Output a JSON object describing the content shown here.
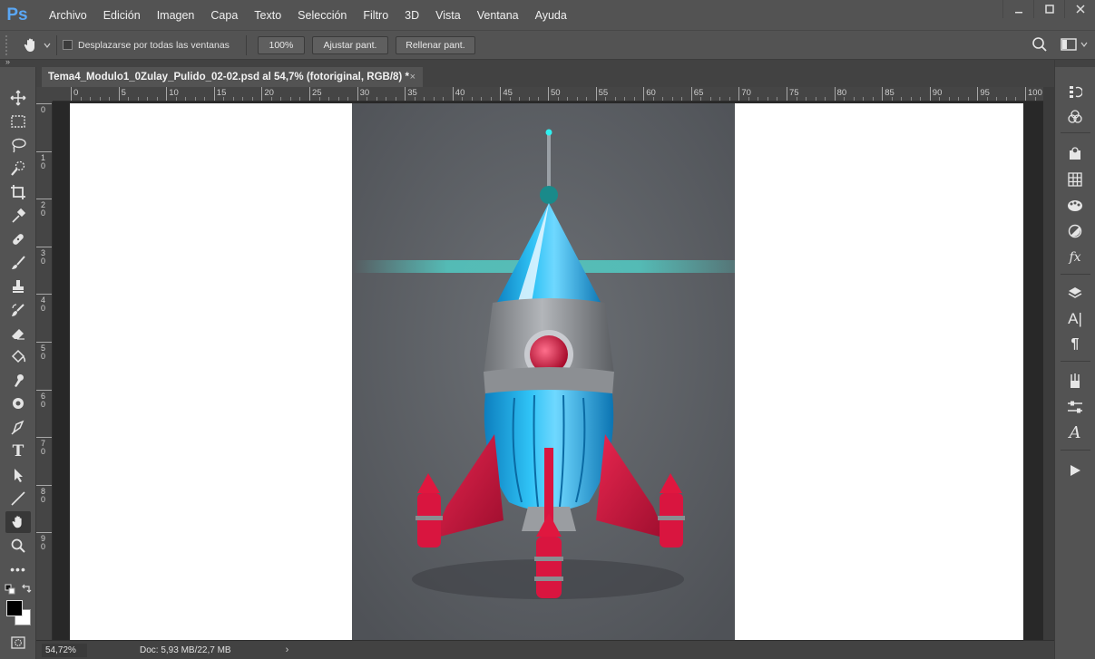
{
  "app": {
    "logo": "Ps"
  },
  "menu": [
    "Archivo",
    "Edición",
    "Imagen",
    "Capa",
    "Texto",
    "Selección",
    "Filtro",
    "3D",
    "Vista",
    "Ventana",
    "Ayuda"
  ],
  "options": {
    "scroll_all_label": "Desplazarse por todas las ventanas",
    "zoom_value": "100%",
    "fit_screen_label": "Ajustar pant.",
    "fill_screen_label": "Rellenar pant."
  },
  "document": {
    "tab_title": "Tema4_Modulo1_0Zulay_Pulido_02-02.psd al 54,7% (fotoriginal, RGB/8) *",
    "close_glyph": "×"
  },
  "ruler_h_labels": [
    "0",
    "5",
    "10",
    "15",
    "20",
    "25",
    "30",
    "35",
    "40",
    "45",
    "50",
    "55",
    "60",
    "65",
    "70",
    "75",
    "80",
    "85",
    "90",
    "95",
    "100"
  ],
  "ruler_v_labels": [
    "0",
    "1\n0",
    "2\n0",
    "3\n0",
    "4\n0",
    "5\n0",
    "6\n0",
    "7\n0",
    "8\n0",
    "9\n0"
  ],
  "status": {
    "zoom": "54,72%",
    "doc_info": "Doc: 5,93 MB/22,7 MB",
    "arrow": "›"
  },
  "colors": {
    "ui_bg": "#535353",
    "pasteboard": "#282828",
    "canvas": "#ffffff",
    "accent_logo": "#5aa7f5",
    "photo_bg": "#5e6166",
    "rocket_blue": "#1fb3ea",
    "rocket_red": "#d9153f",
    "glow_cyan": "#4fe0d6"
  },
  "tools": [
    "move-tool-icon",
    "marquee-tool-icon",
    "lasso-tool-icon",
    "quick-selection-tool-icon",
    "crop-tool-icon",
    "eyedropper-tool-icon",
    "healing-brush-tool-icon",
    "brush-tool-icon",
    "clone-stamp-tool-icon",
    "history-brush-tool-icon",
    "eraser-tool-icon",
    "paint-bucket-tool-icon",
    "smudge-tool-icon",
    "dodge-tool-icon",
    "pen-tool-icon",
    "type-tool-icon",
    "path-selection-tool-icon",
    "line-tool-icon",
    "hand-tool-icon",
    "zoom-tool-icon",
    "more-tools-icon"
  ],
  "dock_panels": [
    "history-panel-icon",
    "color-panel-icon",
    "libraries-panel-icon",
    "swatches-panel-icon",
    "styles-panel-icon",
    "adjustments-panel-icon",
    "fx-panel-icon",
    "layers-panel-icon",
    "character-panel-icon",
    "paragraph-panel-icon",
    "brushes-panel-icon",
    "properties-panel-icon",
    "glyphs-panel-icon",
    "actions-panel-icon"
  ]
}
